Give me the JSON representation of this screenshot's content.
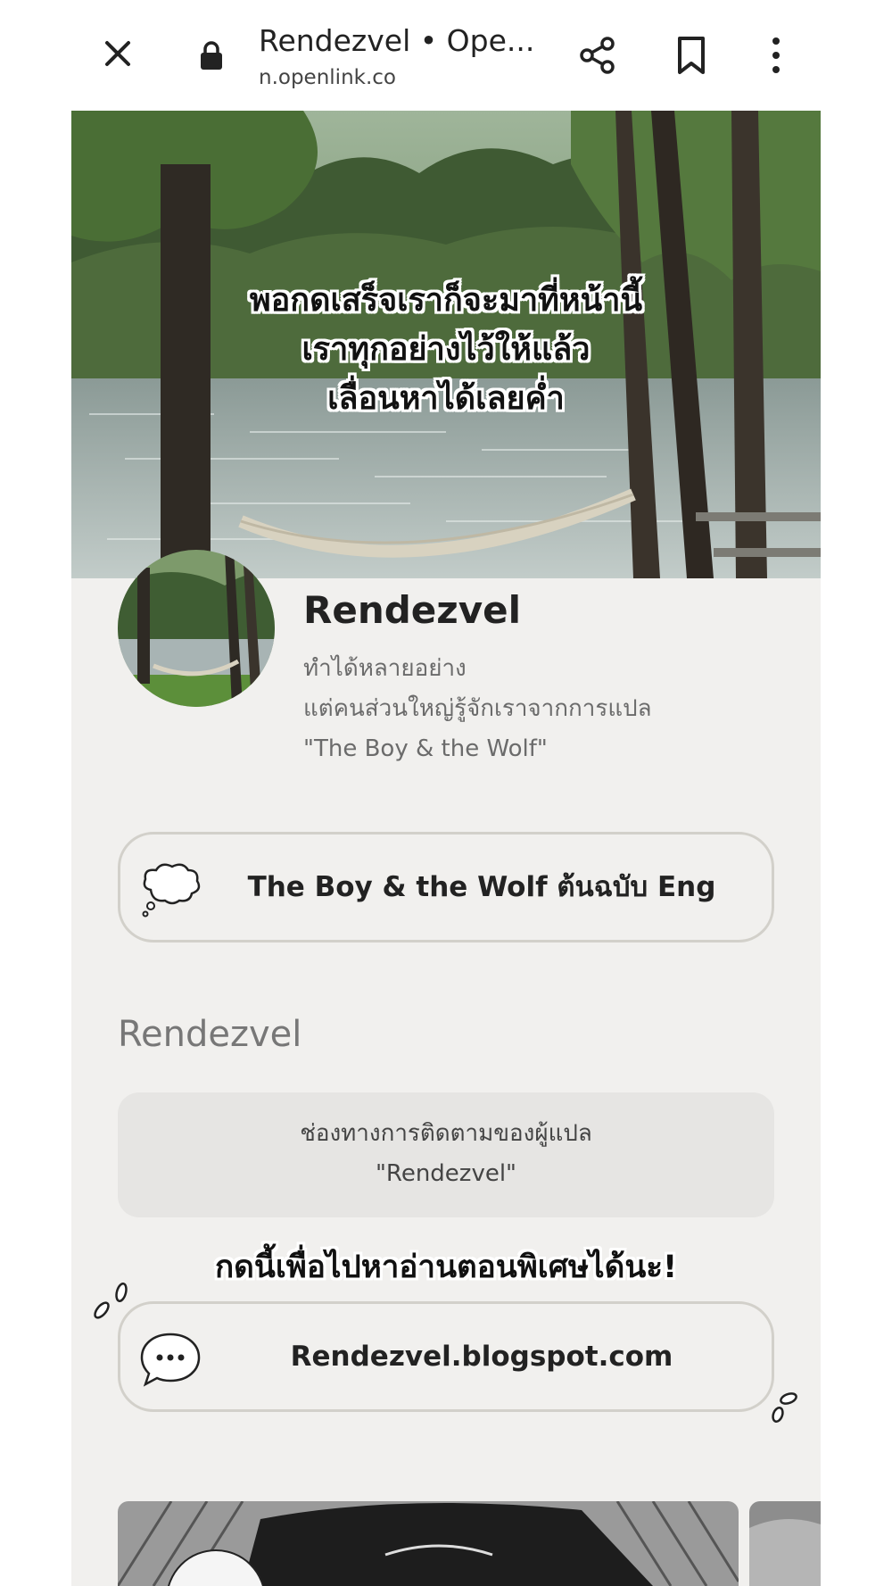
{
  "browser": {
    "title": "Rendezvel • Ope...",
    "url": "n.openlink.co",
    "icons": {
      "close": "close-icon",
      "lock": "lock-icon",
      "share": "share-icon",
      "bookmark": "bookmark-icon",
      "menu": "more-vertical-icon"
    }
  },
  "hero": {
    "caption_lines": [
      "พอกดเสร็จเราก็จะมาที่หน้านี้",
      "เราทุกอย่างไว้ให้แล้ว",
      "เลื่อนหาได้เลยค่ำ"
    ]
  },
  "profile": {
    "name": "Rendezvel",
    "bio_lines": [
      "ทำได้หลายอย่าง",
      "แต่คนส่วนใหญ่รู้จักเราจากการแปล",
      "\"The Boy & the Wolf\""
    ]
  },
  "links": [
    {
      "label": "The Boy & the Wolf ต้นฉบับ Eng",
      "icon": "thought-bubble-icon"
    },
    {
      "label": "Rendezvel.blogspot.com",
      "icon": "speech-bubble-icon"
    }
  ],
  "section": {
    "title": "Rendezvel",
    "note_lines": [
      "ช่องทางการติดตามของผู้แปล",
      "\"Rendezvel\""
    ]
  },
  "promo": "กดนี้เพื่อไปหาอ่านตอนพิเศษได้นะ!",
  "colors": {
    "page_bg": "#f1f0ee",
    "card_bg": "#e6e5e3",
    "button_border": "#d2d0ca",
    "text_dark": "#222222",
    "text_muted": "#6b6b6b"
  }
}
